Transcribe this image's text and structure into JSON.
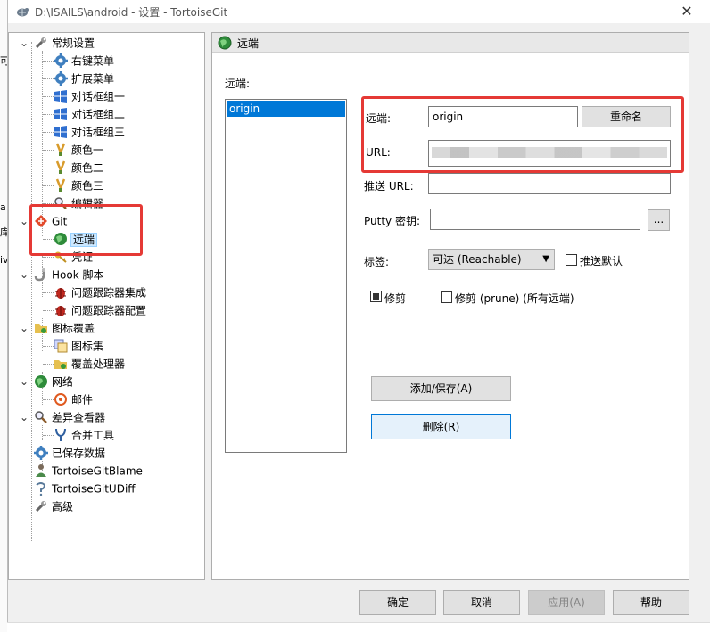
{
  "window": {
    "title": "D:\\ISAILS\\android - 设置 - TortoiseGit",
    "close_glyph": "✕"
  },
  "background_app": {
    "fragments": [
      "可",
      "a",
      "库",
      "iv"
    ]
  },
  "tree": {
    "items": [
      {
        "label": "常规设置",
        "icon": "wrench-icon"
      },
      {
        "label": "右键菜单",
        "icon": "gear-icon"
      },
      {
        "label": "扩展菜单",
        "icon": "gear-icon"
      },
      {
        "label": "对话框组一",
        "icon": "windows-icon"
      },
      {
        "label": "对话框组二",
        "icon": "windows-icon"
      },
      {
        "label": "对话框组三",
        "icon": "windows-icon"
      },
      {
        "label": "颜色一",
        "icon": "brush-icon"
      },
      {
        "label": "颜色二",
        "icon": "brush-icon"
      },
      {
        "label": "颜色三",
        "icon": "brush-icon"
      },
      {
        "label": "编辑器",
        "icon": "magnifier-icon"
      },
      {
        "label": "Git",
        "icon": "git-icon"
      },
      {
        "label": "远端",
        "icon": "globe-icon"
      },
      {
        "label": "凭证",
        "icon": "key-icon"
      },
      {
        "label": "Hook 脚本",
        "icon": "hook-icon"
      },
      {
        "label": "问题跟踪器集成",
        "icon": "bug-icon"
      },
      {
        "label": "问题跟踪器配置",
        "icon": "bug-icon"
      },
      {
        "label": "图标覆盖",
        "icon": "folder-overlay-icon"
      },
      {
        "label": "图标集",
        "icon": "icon-set-icon"
      },
      {
        "label": "覆盖处理器",
        "icon": "folder-overlay-icon"
      },
      {
        "label": "网络",
        "icon": "globe-icon"
      },
      {
        "label": "邮件",
        "icon": "email-icon"
      },
      {
        "label": "差异查看器",
        "icon": "magnifier-icon"
      },
      {
        "label": "合并工具",
        "icon": "merge-icon"
      },
      {
        "label": "已保存数据",
        "icon": "gear-icon"
      },
      {
        "label": "TortoiseGitBlame",
        "icon": "blame-icon"
      },
      {
        "label": "TortoiseGitUDiff",
        "icon": "udiff-icon"
      },
      {
        "label": "高级",
        "icon": "wrench-icon"
      }
    ],
    "selected": "远端"
  },
  "panel": {
    "header": "远端",
    "remotes_label": "远端:",
    "remotes": [
      "origin"
    ],
    "remote_label": "远端:",
    "remote_value": "origin",
    "rename_button": "重命名",
    "url_label": "URL:",
    "url_value": "",
    "push_url_label": "推送 URL:",
    "push_url_value": "",
    "putty_label": "Putty 密钥:",
    "putty_value": "",
    "browse_button": "...",
    "tags_label": "标签:",
    "tags_value": "可达 (Reachable)",
    "push_default_label": "推送默认",
    "push_default_checked": false,
    "prune_label": "修剪",
    "prune_checked": true,
    "prune_all_label": "修剪 (prune) (所有远端)",
    "prune_all_checked": false,
    "add_save_button": "添加/保存(A)",
    "delete_button": "删除(R)"
  },
  "footer": {
    "ok": "确定",
    "cancel": "取消",
    "apply": "应用(A)",
    "help": "帮助"
  },
  "colors": {
    "selection": "#0078d7",
    "highlight_box": "#e53935"
  }
}
